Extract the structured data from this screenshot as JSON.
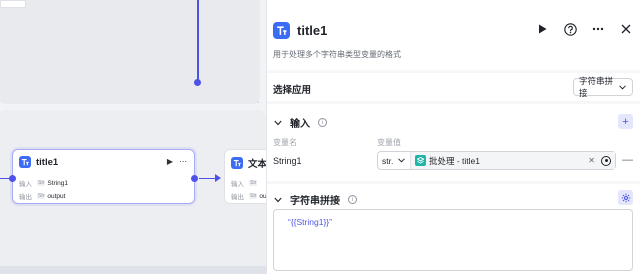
{
  "canvas": {
    "node1": {
      "title": "title1",
      "input_label": "输入",
      "input_type": "Str",
      "input_value": "String1",
      "output_label": "输出",
      "output_type": "Str",
      "output_value": "output"
    },
    "node2": {
      "title": "文本处",
      "input_label": "输入",
      "input_type": "Str",
      "output_label": "输出",
      "output_type": "Str",
      "output_value": "ou"
    }
  },
  "panel": {
    "title": "title1",
    "description": "用于处理多个字符串类型变量的格式",
    "select_app": {
      "label": "选择应用",
      "selected": "字符串拼接"
    },
    "input_section": {
      "title": "输入",
      "col_name": "变量名",
      "col_value": "变量值",
      "rows": [
        {
          "name": "String1",
          "type": "str.",
          "ref": "批处理 - title1"
        }
      ]
    },
    "concat_section": {
      "title": "字符串拼接",
      "template": "“{{String1}}”"
    }
  },
  "colors": {
    "accent": "#4d53e8",
    "node_icon": "#3c6cf4",
    "ref_icon": "#1fb5a8"
  }
}
